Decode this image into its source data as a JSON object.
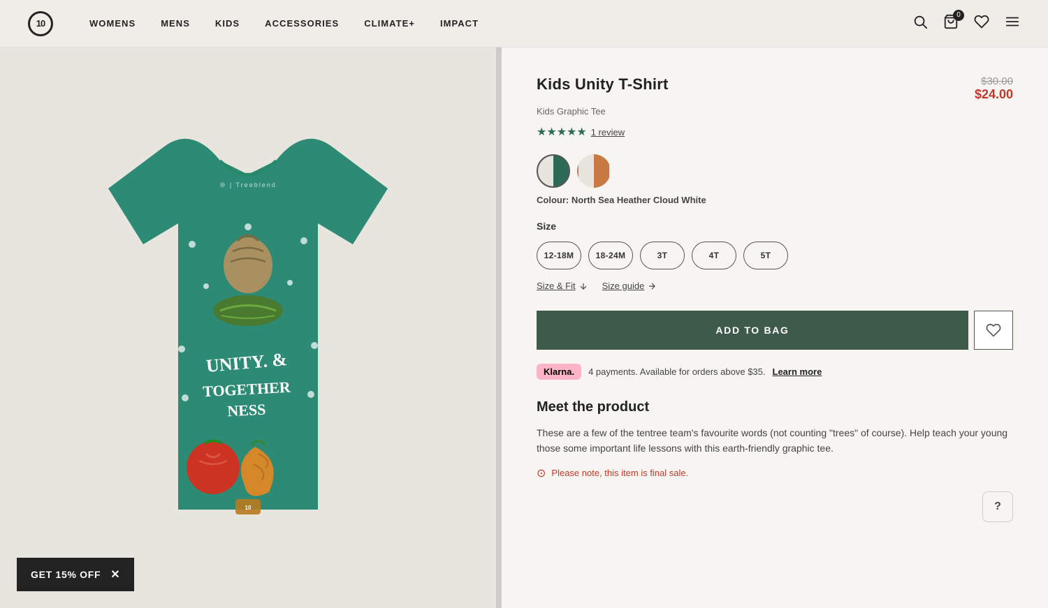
{
  "header": {
    "logo_text": "10",
    "nav": [
      {
        "label": "WOMENS",
        "id": "womens"
      },
      {
        "label": "MENS",
        "id": "mens"
      },
      {
        "label": "KIDS",
        "id": "kids"
      },
      {
        "label": "ACCESSORIES",
        "id": "accessories"
      },
      {
        "label": "CLIMATE+",
        "id": "climate"
      },
      {
        "label": "IMPACT",
        "id": "impact"
      }
    ],
    "cart_count": "0"
  },
  "product": {
    "title": "Kids Unity T-Shirt",
    "subtitle": "Kids Graphic Tee",
    "original_price": "$30.00",
    "sale_price": "$24.00",
    "review_count": "1 review",
    "star_count": "★★★★★",
    "colours": [
      {
        "id": "north-sea",
        "name": "North Sea Heather Cloud White"
      },
      {
        "id": "rust",
        "name": "Rust"
      }
    ],
    "colour_label": "Colour:",
    "colour_value": "North Sea Heather Cloud White",
    "size_label": "Size",
    "sizes": [
      "12-18M",
      "18-24M",
      "3T",
      "4T",
      "5T"
    ],
    "size_fit_link": "Size & Fit",
    "size_guide_link": "Size guide",
    "add_to_bag_label": "ADD TO BAG",
    "klarna_badge": "Klarna.",
    "klarna_text": "4 payments. Available for orders above $35.",
    "klarna_link": "Learn more",
    "meet_title": "Meet the product",
    "meet_text": "These are a few of the tentree team's favourite words (not counting \"trees\" of course). Help teach your young those some important life lessons with this earth-friendly graphic tee.",
    "final_sale_text": "Please note, this item is final sale."
  },
  "promo": {
    "label": "GET 15% OFF",
    "close_label": "✕"
  },
  "help": {
    "label": "?"
  }
}
